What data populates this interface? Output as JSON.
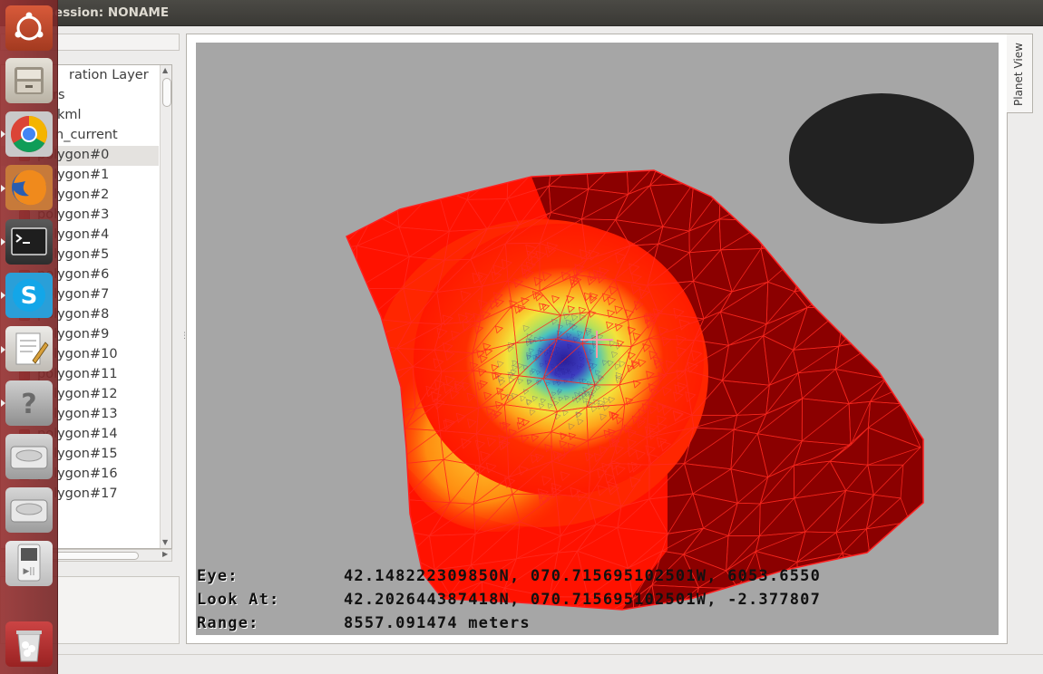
{
  "window": {
    "title": "Planet Session: NONAME",
    "title_visible": "et Session: NONAME"
  },
  "tree": {
    "items": [
      {
        "label": "ration Layer",
        "checkbox": false,
        "selected": false
      },
      {
        "label": "rs",
        "checkbox": false,
        "selected": false
      },
      {
        "label": "kml",
        "checkbox": false,
        "selected": false
      },
      {
        "label": "n_current",
        "checkbox": false,
        "selected": false
      },
      {
        "label": "polygon#0",
        "checkbox": true,
        "selected": true
      },
      {
        "label": "polygon#1",
        "checkbox": true,
        "selected": false
      },
      {
        "label": "polygon#2",
        "checkbox": true,
        "selected": false
      },
      {
        "label": "polygon#3",
        "checkbox": true,
        "selected": false
      },
      {
        "label": "polygon#4",
        "checkbox": true,
        "selected": false
      },
      {
        "label": "polygon#5",
        "checkbox": true,
        "selected": false
      },
      {
        "label": "polygon#6",
        "checkbox": true,
        "selected": false
      },
      {
        "label": "polygon#7",
        "checkbox": true,
        "selected": false
      },
      {
        "label": "polygon#8",
        "checkbox": true,
        "selected": false
      },
      {
        "label": "polygon#9",
        "checkbox": true,
        "selected": false
      },
      {
        "label": "polygon#10",
        "checkbox": true,
        "selected": false
      },
      {
        "label": "polygon#11",
        "checkbox": true,
        "selected": false
      },
      {
        "label": "polygon#12",
        "checkbox": true,
        "selected": false
      },
      {
        "label": "polygon#13",
        "checkbox": true,
        "selected": false
      },
      {
        "label": "polygon#14",
        "checkbox": true,
        "selected": false
      },
      {
        "label": "polygon#15",
        "checkbox": true,
        "selected": false
      },
      {
        "label": "polygon#16",
        "checkbox": true,
        "selected": false
      },
      {
        "label": "polygon#17",
        "checkbox": true,
        "selected": false
      }
    ]
  },
  "planet_view": {
    "tab_label": "Planet View",
    "hud": {
      "eye_label": "Eye:",
      "eye_value": "42.148222309850N, 070.715695102501W, 6053.6550",
      "look_label": "Look At:",
      "look_value": "42.202644387418N, 070.715695102501W, -2.377807",
      "range_label": "Range:",
      "range_value": "8557.091474 meters"
    },
    "colors": {
      "background": "#a6a6a6",
      "mesh_dark": "#8b0000",
      "mesh_mid": "#ff1a00",
      "mesh_edge": "#ff2020",
      "hotspot_blue": "#2a1f9a",
      "disc": "#222222"
    }
  },
  "launcher": {
    "items": [
      {
        "name": "dash-home-icon",
        "color": "#c8472b"
      },
      {
        "name": "files-icon",
        "color": "#bdb6a8"
      },
      {
        "name": "chrome-icon",
        "color": "#4a8cf0"
      },
      {
        "name": "firefox-icon",
        "color": "#e8792a"
      },
      {
        "name": "terminal-icon",
        "color": "#2d2d2d"
      },
      {
        "name": "skype-icon",
        "color": "#13a6e8"
      },
      {
        "name": "text-editor-icon",
        "color": "#d9d4cb"
      },
      {
        "name": "help-icon",
        "color": "#9a9a9a"
      },
      {
        "name": "drive-icon",
        "color": "#b9b9b9"
      },
      {
        "name": "drive-icon",
        "color": "#b9b9b9"
      },
      {
        "name": "media-player-icon",
        "color": "#dadada"
      },
      {
        "name": "trash-icon",
        "color": "#c9c9c9"
      }
    ]
  }
}
